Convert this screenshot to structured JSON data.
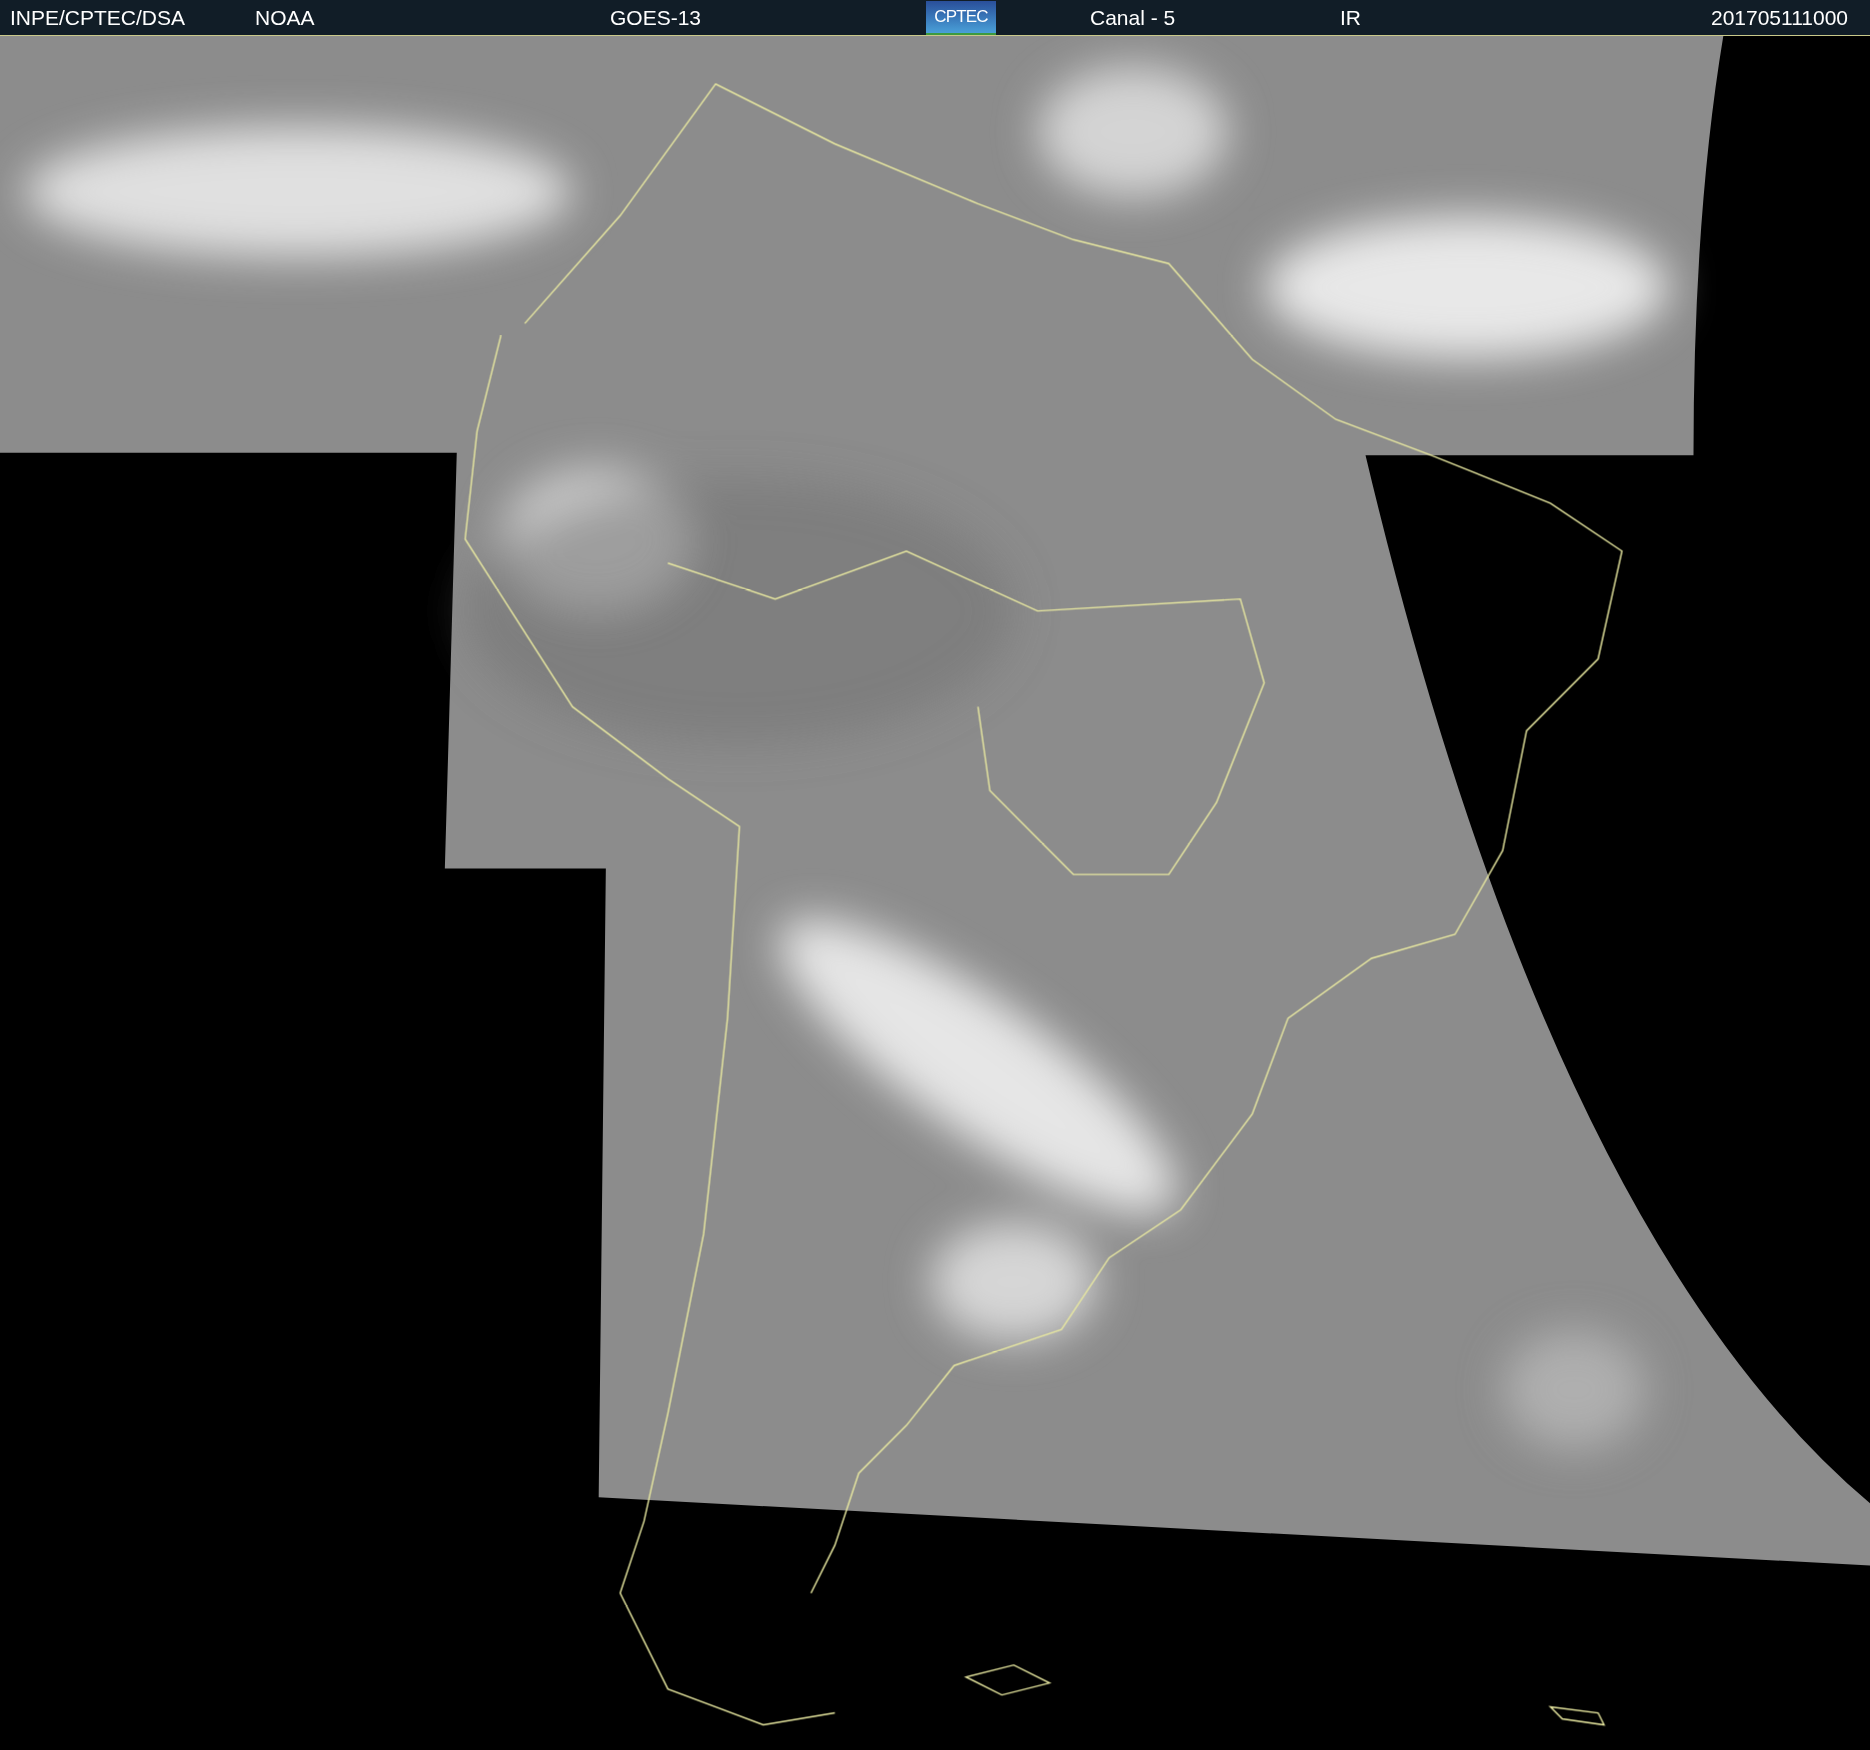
{
  "header": {
    "items": [
      {
        "kind": "text",
        "text": "INPE/CPTEC/DSA"
      },
      {
        "kind": "text",
        "text": "NOAA"
      },
      {
        "kind": "text",
        "text": "GOES-13"
      },
      {
        "kind": "logo",
        "text": "CPTEC"
      },
      {
        "kind": "text",
        "text": "Canal - 5"
      },
      {
        "kind": "text",
        "text": "IR"
      },
      {
        "kind": "text",
        "text": "201705111000"
      }
    ]
  }
}
